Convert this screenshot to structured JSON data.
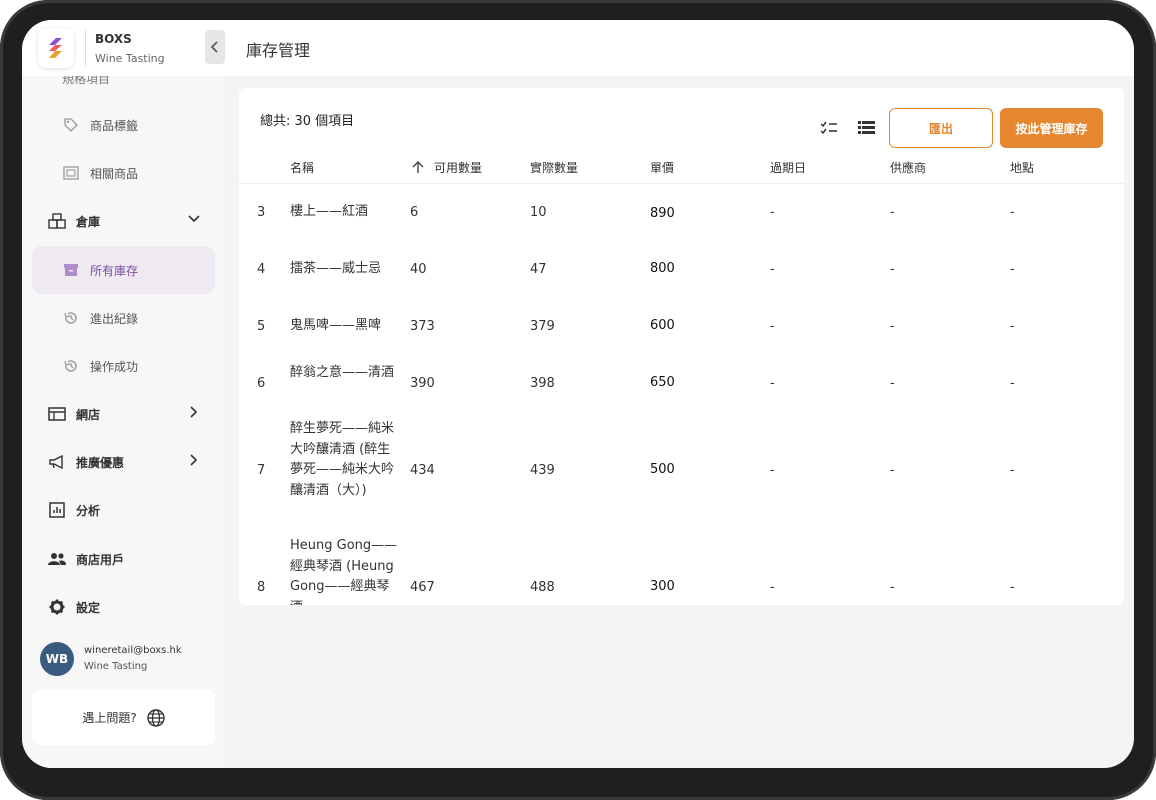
{
  "brand": {
    "name": "BOXS",
    "subtitle": "Wine Tasting"
  },
  "sidebar": {
    "partial_item": "規格項目",
    "items": [
      {
        "label": "商品標籤",
        "icon": "tag-icon"
      },
      {
        "label": "相關商品",
        "icon": "related-icon"
      },
      {
        "label": "倉庫",
        "icon": "warehouse-icon",
        "expanded": true
      },
      {
        "label": "所有庫存",
        "icon": "archive-icon",
        "active": true
      },
      {
        "label": "進出紀錄",
        "icon": "history-icon"
      },
      {
        "label": "操作成功",
        "icon": "history-icon"
      },
      {
        "label": "網店",
        "icon": "store-icon"
      },
      {
        "label": "推廣優惠",
        "icon": "megaphone-icon"
      },
      {
        "label": "分析",
        "icon": "analytics-icon"
      },
      {
        "label": "商店用戶",
        "icon": "users-icon"
      },
      {
        "label": "設定",
        "icon": "gear-icon"
      }
    ],
    "user": {
      "initials": "WB",
      "email": "wineretail@boxs.hk",
      "shop": "Wine Tasting"
    },
    "help": "遇上問題?"
  },
  "header": {
    "title": "庫存管理"
  },
  "toolbar": {
    "total": "總共: 30 個項目",
    "export_label": "匯出",
    "manage_label": "按此管理庫存"
  },
  "table": {
    "columns": [
      "名稱",
      "可用數量",
      "實際數量",
      "單價",
      "過期日",
      "供應商",
      "地點"
    ],
    "rows": [
      {
        "no": "3",
        "name": "樓上——紅酒",
        "available": "6",
        "actual": "10",
        "price": "890",
        "expiry": "-",
        "supplier": "-",
        "location": "-"
      },
      {
        "no": "4",
        "name": "擂茶——威士忌",
        "available": "40",
        "actual": "47",
        "price": "800",
        "expiry": "-",
        "supplier": "-",
        "location": "-"
      },
      {
        "no": "5",
        "name": "鬼馬啤——黑啤",
        "available": "373",
        "actual": "379",
        "price": "600",
        "expiry": "-",
        "supplier": "-",
        "location": "-"
      },
      {
        "no": "6",
        "name": "醉翁之意——清酒",
        "available": "390",
        "actual": "398",
        "price": "650",
        "expiry": "-",
        "supplier": "-",
        "location": "-"
      },
      {
        "no": "7",
        "name": "醉生夢死——純米大吟釀清酒 (醉生夢死——純米大吟釀清酒（大）)",
        "available": "434",
        "actual": "439",
        "price": "500",
        "expiry": "-",
        "supplier": "-",
        "location": "-"
      },
      {
        "no": "8",
        "name": "Heung Gong——經典琴酒 (Heung Gong——經典琴酒",
        "available": "467",
        "actual": "488",
        "price": "300",
        "expiry": "-",
        "supplier": "-",
        "location": "-"
      }
    ]
  },
  "colors": {
    "accent": "#e6862f",
    "active_bg": "#efe9f2",
    "active_text": "#7b4fa0",
    "avatar": "#3a5a80"
  }
}
